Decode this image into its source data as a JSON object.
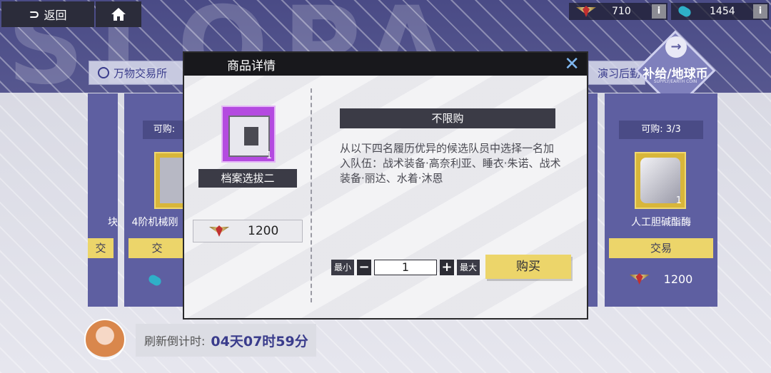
{
  "nav": {
    "back_label": "返回",
    "home_icon": "home-icon"
  },
  "resources": [
    {
      "icon": "medal-icon",
      "value": "710",
      "info": "i"
    },
    {
      "icon": "capsule-icon",
      "value": "1454",
      "info": "i"
    }
  ],
  "background": {
    "letters": "SLOPA"
  },
  "tabs": {
    "market": "万物交易所",
    "drill": "演习后勤"
  },
  "supply_badge": {
    "label": "补给/地球币",
    "sub": "SUPPLY/EARTH COIN"
  },
  "cards": [
    {
      "name": "块",
      "trade_label": "交"
    },
    {
      "stock": "可购:",
      "name": "4阶机械刚",
      "trade_label": "交"
    },
    {
      "stock": "可购: 3/3",
      "qty": "1",
      "name": "人工胆碱酯酶",
      "trade_label": "交易",
      "price": "1200"
    }
  ],
  "refresh": {
    "label": "刷新倒计时:",
    "time": "04天07时59分"
  },
  "modal": {
    "title": "商品详情",
    "item_name": "档案选拔二",
    "item_count": "1",
    "cost": "1200",
    "limit_label": "不限购",
    "description": "从以下四名履历优异的候选队员中选择一名加入队伍：战术装备·高奈利亚、睡衣·朱诺、战术装备·丽达、水着·沐恩",
    "qty_min_label": "最小",
    "qty_max_label": "最大",
    "qty_value": "1",
    "minus": "−",
    "plus": "+",
    "buy_label": "购买"
  }
}
